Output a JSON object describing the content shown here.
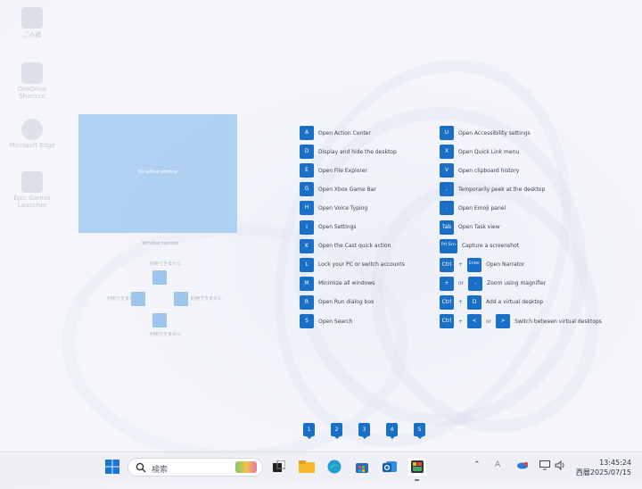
{
  "desktop": {
    "icons": [
      {
        "label": "ごみ箱"
      },
      {
        "label": "OneDrive Shortcut"
      },
      {
        "label": "Microsoft Edge"
      },
      {
        "label": "Epic Games Launcher"
      }
    ]
  },
  "preview": {
    "window_text": "No active window",
    "controls_title": "Window controls",
    "unavailable": "利用できません"
  },
  "shortcuts_left": [
    {
      "key": "A",
      "label": "Open Action Center"
    },
    {
      "key": "D",
      "label": "Display and hide the desktop"
    },
    {
      "key": "E",
      "label": "Open File Explorer"
    },
    {
      "key": "G",
      "label": "Open Xbox Game Bar"
    },
    {
      "key": "H",
      "label": "Open Voice Typing"
    },
    {
      "key": "I",
      "label": "Open Settings"
    },
    {
      "key": "K",
      "label": "Open the Cast quick action"
    },
    {
      "key": "L",
      "label": "Lock your PC or switch accounts"
    },
    {
      "key": "M",
      "label": "Minimize all windows"
    },
    {
      "key": "R",
      "label": "Open Run dialog box"
    },
    {
      "key": "S",
      "label": "Open Search"
    }
  ],
  "shortcuts_right": [
    {
      "keys": [
        "U"
      ],
      "seps": [],
      "label": "Open Accessibility settings"
    },
    {
      "keys": [
        "X"
      ],
      "seps": [],
      "label": "Open Quick Link menu"
    },
    {
      "keys": [
        "V"
      ],
      "seps": [],
      "label": "Open clipboard history"
    },
    {
      "keys": [
        ","
      ],
      "seps": [],
      "label": "Temporarily peek at the desktop"
    },
    {
      "keys": [
        "."
      ],
      "seps": [],
      "label": "Open Emoji panel"
    },
    {
      "keys": [
        "Tab"
      ],
      "seps": [],
      "label": "Open Task view"
    },
    {
      "keys": [
        "Prt Scn"
      ],
      "seps": [],
      "label": "Capture a screenshot"
    },
    {
      "keys": [
        "Ctrl",
        "Enter"
      ],
      "seps": [
        "+"
      ],
      "label": "Open Narrator"
    },
    {
      "keys": [
        "+",
        "-"
      ],
      "seps": [
        "or"
      ],
      "label": "Zoom using magnifier"
    },
    {
      "keys": [
        "Ctrl",
        "D"
      ],
      "seps": [
        "+"
      ],
      "label": "Add a virtual desktop"
    },
    {
      "keys": [
        "Ctrl",
        "<",
        ">"
      ],
      "seps": [
        "+",
        "or"
      ],
      "label": "Switch between virtual desktops"
    }
  ],
  "virtual_desktops": [
    "1",
    "2",
    "3",
    "4",
    "5"
  ],
  "taskbar": {
    "search_placeholder": "検索",
    "time": "13:45:24",
    "date": "西暦2025/07/15",
    "ime": "A"
  },
  "colors": {
    "key_blue": "#1a6fc6",
    "preview_blue": "#a9cdf1"
  }
}
